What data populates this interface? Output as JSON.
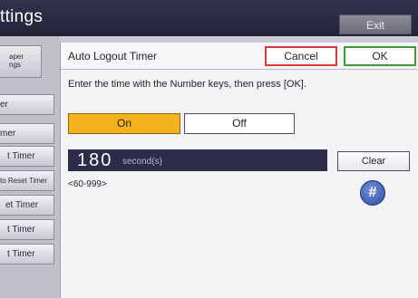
{
  "header": {
    "title": "ttings",
    "exit_label": "Exit"
  },
  "sidebar": {
    "tabs": [
      {
        "label": "aper\nngs"
      },
      {
        "label": "er"
      },
      {
        "label": "mer"
      },
      {
        "label": "t Timer"
      },
      {
        "label": "to Reset Timer"
      },
      {
        "label": "et Timer"
      },
      {
        "label": "t Timer"
      },
      {
        "label": "t Timer"
      }
    ]
  },
  "dialog": {
    "title": "Auto Logout Timer",
    "cancel_label": "Cancel",
    "ok_label": "OK",
    "instruction": "Enter the time with the Number keys, then press [OK].",
    "on_label": "On",
    "off_label": "Off",
    "value": "180",
    "unit": "second(s)",
    "clear_label": "Clear",
    "range": "<60-999>",
    "hash_label": "#"
  }
}
